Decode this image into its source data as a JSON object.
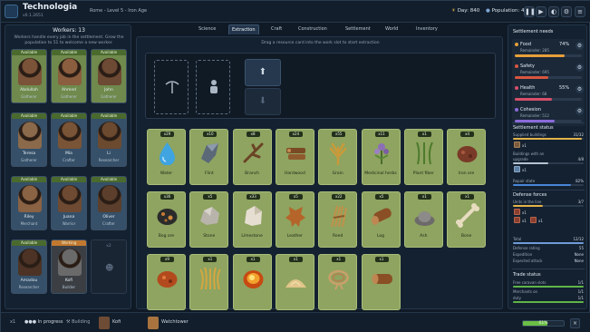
{
  "header": {
    "title": "Technologia",
    "version": "v0.1.2651",
    "subtitle": "Rome - Level 5 - Iron Age",
    "day": "Day: 840",
    "population": "Population: 49",
    "controls": [
      "pause",
      "play",
      "fast-forward",
      "ultra-fast",
      "help",
      "settings",
      "menu"
    ]
  },
  "workers": {
    "title": "Workers: 13",
    "note": "Workers handle every job in the settlement. Grow the population to 51 to welcome a new worker.",
    "cards": [
      {
        "status": "Available",
        "name": "Abdullah",
        "role": "Gatherer"
      },
      {
        "status": "Available",
        "name": "Ahmed",
        "role": "Gatherer"
      },
      {
        "status": "Available",
        "name": "John",
        "role": "Gatherer"
      },
      {
        "status": "Available",
        "name": "Teresa",
        "role": "Gatherer"
      },
      {
        "status": "Available",
        "name": "Mia",
        "role": "Crafter"
      },
      {
        "status": "Available",
        "name": "Li",
        "role": "Researcher"
      },
      {
        "status": "Available",
        "name": "Riley",
        "role": "Merchant"
      },
      {
        "status": "Available",
        "name": "Juana",
        "role": "Warrior"
      },
      {
        "status": "Available",
        "name": "Oliver",
        "role": "Crafter"
      },
      {
        "status": "Available",
        "name": "Amadou",
        "role": "Researcher"
      },
      {
        "status": "Working",
        "name": "Kofi",
        "role": "Builder"
      }
    ],
    "locked_slot": {
      "count": "x2"
    }
  },
  "tabs": [
    "Science",
    "Extraction",
    "Craft",
    "Construction",
    "Settlement",
    "World",
    "Inventory"
  ],
  "active_tab": "Extraction",
  "extraction": {
    "hint": "Drag a resource card into the work slot to start extraction",
    "upload_icon": "upload-arrow-icon",
    "download_icon": "download-arrow-icon"
  },
  "resources": [
    {
      "qty": "x29",
      "name": "Water",
      "art": "water"
    },
    {
      "qty": "x10",
      "name": "Flint",
      "art": "flint"
    },
    {
      "qty": "x8",
      "name": "Branch",
      "art": "branch"
    },
    {
      "qty": "x24",
      "name": "Hardwood",
      "art": "hardwood"
    },
    {
      "qty": "x55",
      "name": "Grain",
      "art": "grain"
    },
    {
      "qty": "x11",
      "name": "Medicinal herbs",
      "art": "herbs"
    },
    {
      "qty": "x1",
      "name": "Plant fiber",
      "art": "fiber"
    },
    {
      "qty": "x4",
      "name": "Iron ore",
      "art": "ironore"
    },
    {
      "qty": "x36",
      "name": "Bog ore",
      "art": "bogore"
    },
    {
      "qty": "x5",
      "name": "Stone",
      "art": "stone"
    },
    {
      "qty": "x33",
      "name": "Limestone",
      "art": "limestone"
    },
    {
      "qty": "x5",
      "name": "Leather",
      "art": "leather"
    },
    {
      "qty": "x22",
      "name": "Reed",
      "art": "reed"
    },
    {
      "qty": "x5",
      "name": "Log",
      "art": "log"
    },
    {
      "qty": "x1",
      "name": "Ash",
      "art": "ash"
    },
    {
      "qty": "x1",
      "name": "Bone",
      "art": "bone"
    },
    {
      "qty": "x9",
      "name": "",
      "art": "ore2"
    },
    {
      "qty": "x1",
      "name": "",
      "art": "grass"
    },
    {
      "qty": "x1",
      "name": "",
      "art": "ember"
    },
    {
      "qty": "x1",
      "name": "",
      "art": "sand"
    },
    {
      "qty": "x1",
      "name": "",
      "art": "rope"
    },
    {
      "qty": "x1",
      "name": "",
      "art": "log2"
    }
  ],
  "settlement_needs": {
    "title": "Settlement needs",
    "items": [
      {
        "name": "Food",
        "remainder": "Remainder: 285",
        "percent": "74%",
        "color": "#e6a03a",
        "fill": 0.74
      },
      {
        "name": "Safety",
        "remainder": "Remainder: 695",
        "percent": "",
        "color": "#d8563f",
        "fill": 0.5
      },
      {
        "name": "Health",
        "remainder": "Remainder: 68",
        "percent": "55%",
        "color": "#d84f6a",
        "fill": 0.55
      },
      {
        "name": "Cohesion",
        "remainder": "Remainder: 512",
        "percent": "",
        "color": "#8a6ad8",
        "fill": 0.6
      }
    ]
  },
  "settlement_status": {
    "title": "Settlement status",
    "rows": [
      {
        "label": "Supplied buildings",
        "value": "31/32"
      },
      {
        "label": "Buildings with an",
        "value": ""
      },
      {
        "label": "upgrade",
        "value": "4/8"
      },
      {
        "label": "Repair state",
        "value": "82%"
      }
    ],
    "items": [
      {
        "label": "x1"
      },
      {
        "label": "x1"
      }
    ]
  },
  "defense": {
    "title": "Defense forces",
    "units_label": "Units in the line",
    "units_value": "3/7",
    "items": [
      {
        "label": "x1"
      },
      {
        "label": "x1"
      },
      {
        "label": "x1"
      }
    ],
    "rows": [
      {
        "label": "Total",
        "value": "12/12"
      },
      {
        "label": "Defense rating",
        "value": "55"
      },
      {
        "label": "Expedition",
        "value": "None"
      },
      {
        "label": "Expected attack",
        "value": "None"
      }
    ]
  },
  "trade": {
    "title": "Trade status",
    "rows": [
      {
        "label": "Free caravan slots",
        "value": "1/1"
      },
      {
        "label": "Merchants on",
        "value": "1/1"
      },
      {
        "label": "duty",
        "value": "1/1"
      }
    ]
  },
  "bottom": {
    "count": "x1",
    "in_progress": "In progress",
    "building": "Building",
    "worker": "Kofi",
    "target": "Watchtower",
    "progress": 0.61,
    "progress_label": "61%",
    "close": "×"
  }
}
